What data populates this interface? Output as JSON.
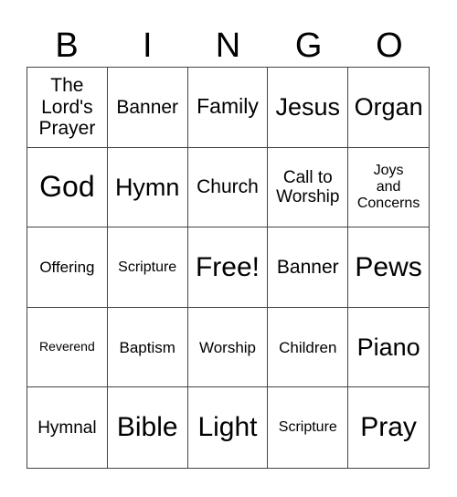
{
  "header": [
    "B",
    "I",
    "N",
    "G",
    "O"
  ],
  "cells": [
    [
      "The\nLord's\nPrayer",
      "Banner",
      "Family",
      "Jesus",
      "Organ"
    ],
    [
      "God",
      "Hymn",
      "Church",
      "Call to\nWorship",
      "Joys\nand\nConcerns"
    ],
    [
      "Offering",
      "Scripture",
      "Free!",
      "Banner",
      "Pews"
    ],
    [
      "Reverend",
      "Baptism",
      "Worship",
      "Children",
      "Piano"
    ],
    [
      "Hymnal",
      "Bible",
      "Light",
      "Scripture",
      "Pray"
    ]
  ]
}
